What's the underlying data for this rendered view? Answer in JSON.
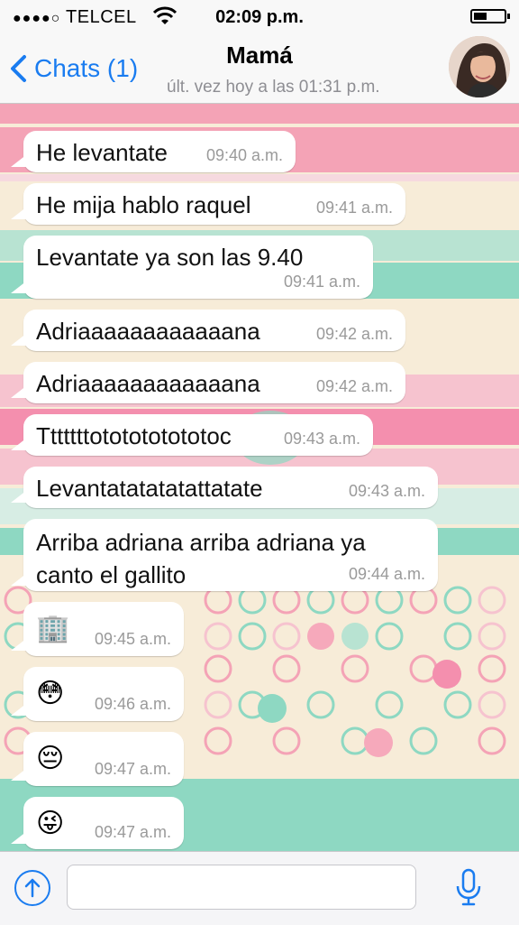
{
  "status_bar": {
    "signal": "●●●●○",
    "carrier": "TELCEL",
    "time": "02:09 p.m."
  },
  "header": {
    "back_label": "Chats (1)",
    "title": "Mamá",
    "last_seen": "últ. vez hoy a las 01:31 p.m."
  },
  "messages": [
    {
      "text": "He levantate",
      "time": "09:40 a.m."
    },
    {
      "text": "He mija hablo raquel",
      "time": "09:41 a.m."
    },
    {
      "text": "Levantate ya son las 9.40",
      "time": "09:41 a.m."
    },
    {
      "text": "Adriaaaaaaaaaaaana",
      "time": "09:42 a.m."
    },
    {
      "text": "Adriaaaaaaaaaaaana",
      "time": "09:42 a.m."
    },
    {
      "text": "Tttttttototototototoc",
      "time": "09:43 a.m."
    },
    {
      "text": "Levantatatatatattatate",
      "time": "09:43 a.m."
    },
    {
      "text": "Arriba adriana arriba adriana ya canto el gallito",
      "time": "09:44 a.m."
    },
    {
      "emoji": "🏢",
      "time": "09:45 a.m.",
      "icon": "office-building-emoji"
    },
    {
      "emoji": "😳",
      "time": "09:46 a.m.",
      "icon": "flushed-face-emoji"
    },
    {
      "emoji": "😔",
      "time": "09:47 a.m.",
      "icon": "pensive-face-emoji"
    },
    {
      "emoji": "😜",
      "time": "09:47 a.m.",
      "icon": "winking-tongue-face-emoji"
    }
  ],
  "input": {
    "placeholder": ""
  },
  "colors": {
    "accent": "#1a7cf0",
    "bubble": "#ffffff",
    "wallpaper_pink": "#f4a3b6",
    "wallpaper_mint": "#8ed8c2",
    "wallpaper_cream": "#f7ecd8"
  }
}
